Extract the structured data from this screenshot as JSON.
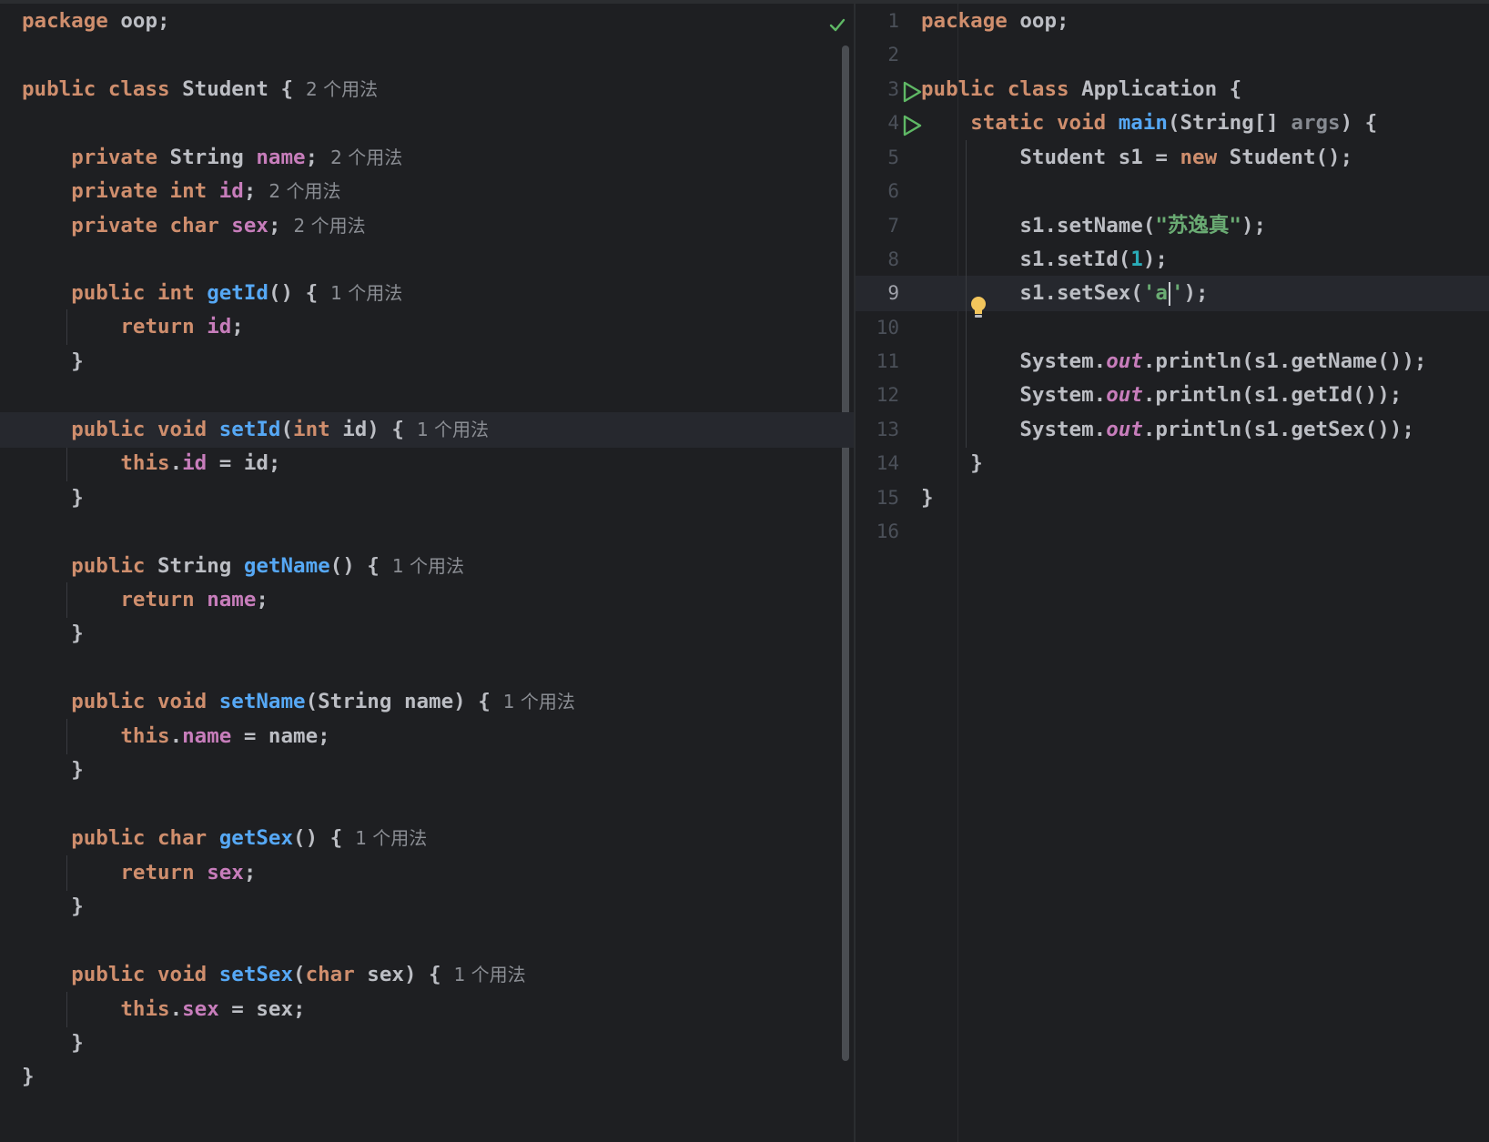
{
  "left_editor": {
    "lines": {
      "l1": {
        "kw": "package",
        "rest": " oop;"
      },
      "l3": {
        "kw": "public class",
        "name": " Student ",
        "brace": "{",
        "hint": "2 个用法"
      },
      "l5": {
        "kw": "private",
        "type": " String ",
        "fld": "name",
        "end": ";",
        "hint": "2 个用法"
      },
      "l6": {
        "kw": "private int",
        "fld": "id",
        "end": ";",
        "hint": "2 个用法"
      },
      "l7": {
        "kw": "private char",
        "fld": "sex",
        "end": ";",
        "hint": "2 个用法"
      },
      "l9": {
        "kw": "public int",
        "fn": "getId",
        "end": "() {",
        "hint": "1 个用法"
      },
      "l10": {
        "kw": "return",
        "fld": "id",
        "end": ";"
      },
      "l11": {
        "brace": "}"
      },
      "l13": {
        "kw": "public void",
        "fn": "setId",
        "open": "(",
        "kw2": "int",
        "end": " id) {",
        "hint": "1 个用法"
      },
      "l14": {
        "kw": "this",
        "dot": ".",
        "fld": "id",
        "end": " = id;"
      },
      "l15": {
        "brace": "}"
      },
      "l17": {
        "kw": "public",
        "type": " String ",
        "fn": "getName",
        "end": "() {",
        "hint": "1 个用法"
      },
      "l18": {
        "kw": "return",
        "fld": "name",
        "end": ";"
      },
      "l19": {
        "brace": "}"
      },
      "l21": {
        "kw": "public void",
        "fn": "setName",
        "end": "(String name) {",
        "hint": "1 个用法"
      },
      "l22": {
        "kw": "this",
        "dot": ".",
        "fld": "name",
        "end": " = name;"
      },
      "l23": {
        "brace": "}"
      },
      "l25": {
        "kw": "public char",
        "fn": "getSex",
        "end": "() {",
        "hint": "1 个用法"
      },
      "l26": {
        "kw": "return",
        "fld": "sex",
        "end": ";"
      },
      "l27": {
        "brace": "}"
      },
      "l29": {
        "kw": "public void",
        "fn": "setSex",
        "open": "(",
        "kw2": "char",
        "end": " sex) {",
        "hint": "1 个用法"
      },
      "l30": {
        "kw": "this",
        "dot": ".",
        "fld": "sex",
        "end": " = sex;"
      },
      "l31": {
        "brace": "}"
      },
      "l32": {
        "brace": "}"
      }
    }
  },
  "right_editor": {
    "line_numbers": [
      "1",
      "2",
      "3",
      "4",
      "5",
      "6",
      "7",
      "8",
      "9",
      "10",
      "11",
      "12",
      "13",
      "14",
      "15",
      "16"
    ],
    "current_line": "9",
    "lines": {
      "l1": {
        "kw": "package",
        "rest": " oop;"
      },
      "l3": {
        "kw": "public class",
        "rest": " Application {"
      },
      "l4": {
        "kw": "static void",
        "fn": "main",
        "open": "(String[] ",
        "param": "args",
        "end": ") {"
      },
      "l5": {
        "pre": "Student s1 = ",
        "kw": "new",
        "end": " Student();"
      },
      "l7": {
        "pre": "s1.setName(",
        "str": "\"苏逸真\"",
        "end": ");"
      },
      "l8": {
        "pre": "s1.setId(",
        "num": "1",
        "end": ");"
      },
      "l9": {
        "pre": "s1.setSex(",
        "str_a": "'a",
        "str_b": "'",
        "end": ");"
      },
      "l11": {
        "pre": "System.",
        "sfld": "out",
        "end": ".println(s1.getName());"
      },
      "l12": {
        "pre": "System.",
        "sfld": "out",
        "end": ".println(s1.getId());"
      },
      "l13": {
        "pre": "System.",
        "sfld": "out",
        "end": ".println(s1.getSex());"
      },
      "l14": {
        "brace": "}"
      },
      "l15": {
        "brace": "}"
      }
    }
  },
  "icons": {
    "inspection": "check-icon",
    "run": "run-gutter-icon",
    "intention": "lightbulb-icon"
  },
  "colors": {
    "background": "#1e1f22",
    "keyword": "#cf8e6d",
    "field": "#c77dbb",
    "function": "#56a8f5",
    "string": "#6aab73",
    "number": "#2aacb8",
    "check": "#5fb865",
    "run": "#5fb865",
    "bulb": "#f2c55c"
  }
}
